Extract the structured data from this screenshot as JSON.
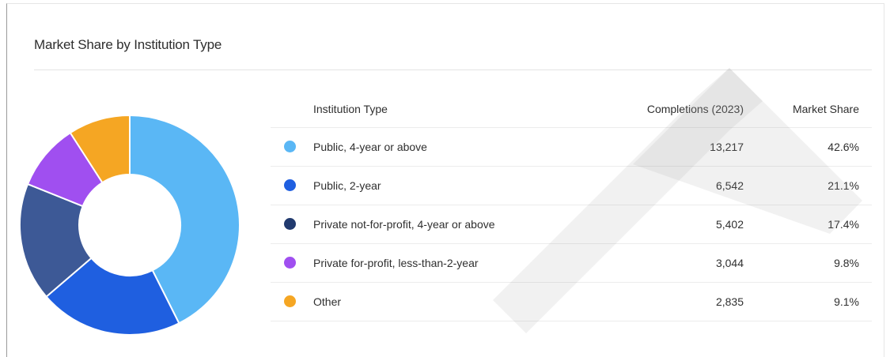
{
  "card": {
    "title": "Market Share by Institution Type"
  },
  "table": {
    "headers": {
      "type": "Institution Type",
      "completions": "Completions (2023)",
      "share": "Market Share"
    },
    "rows": [
      {
        "type": "Public, 4-year or above",
        "completions": "13,217",
        "share": "42.6%",
        "color": "#5ab7f5"
      },
      {
        "type": "Public, 2-year",
        "completions": "6,542",
        "share": "21.1%",
        "color": "#1f5fe0"
      },
      {
        "type": "Private not-for-profit, 4-year or above",
        "completions": "5,402",
        "share": "17.4%",
        "color": "#213a6e"
      },
      {
        "type": "Private for-profit, less-than-2-year",
        "completions": "3,044",
        "share": "9.8%",
        "color": "#a04ff0"
      },
      {
        "type": "Other",
        "completions": "2,835",
        "share": "9.1%",
        "color": "#f5a623"
      }
    ]
  },
  "chart_data": {
    "type": "pie",
    "title": "Market Share by Institution Type",
    "donut": true,
    "categories": [
      "Public, 4-year or above",
      "Public, 2-year",
      "Private not-for-profit, 4-year or above",
      "Private for-profit, less-than-2-year",
      "Other"
    ],
    "values": [
      42.6,
      21.1,
      17.4,
      9.8,
      9.1
    ],
    "colors": [
      "#5ab7f5",
      "#1f5fe0",
      "#3d5996",
      "#a04ff0",
      "#f5a623"
    ]
  }
}
